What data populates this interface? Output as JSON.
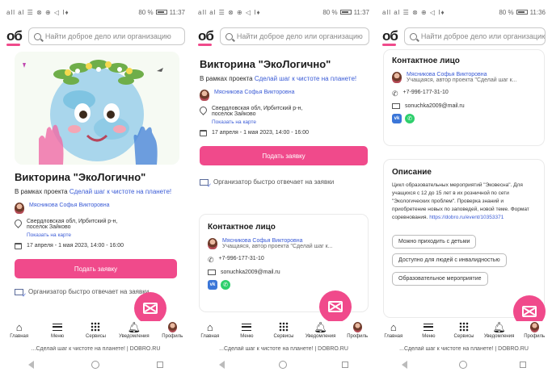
{
  "status": {
    "signal": "all al ☰ ⊗ ⊕ ◁ I♦",
    "battery": "80 %",
    "times": [
      "11:37",
      "11:37",
      "11:36"
    ]
  },
  "header": {
    "logo": "об",
    "search_placeholder": "Найти доброе дело или организацию"
  },
  "event": {
    "title": "Викторина \"ЭкоЛогично\"",
    "subtitle_prefix": "В рамках проекта ",
    "project_link": "Сделай шаг к чистоте на планете!",
    "organizer_name": "Мясникова Софья Викторовна",
    "address": "Свердловская обл, Ирбитский р-н, поселок Зайково",
    "map_link": "Показать на карте",
    "dates": "17 апреля - 1 мая 2023, 14:00 - 16:00",
    "apply_button": "Подать заявку",
    "fast_reply_note": "Организатор быстро отвечает на заявки"
  },
  "contact": {
    "title": "Контактное лицо",
    "name": "Мясникова Софья Викторовна",
    "role": "Учащаяся, автор проекта \"Сделай шаг к...",
    "phone": "+7-996-177-31-10",
    "email": "sonuchka2009@mail.ru",
    "vk": "vk",
    "whatsapp": "✆"
  },
  "description": {
    "title": "Описание",
    "text": "Цикл образовательных мероприятий \"Эковесна\". Для учащихся с 12 до 15 лет в их розничной по сети \"Экологических проблем\". Проверка знаний и приобретение новых по заповедей, новой теме. Формат соревнования. ",
    "link": "https://dobro.ru/event/10353371",
    "tags": [
      "Можно приходить с детьми",
      "Доступно для людей с инвалидностью",
      "Образовательное мероприятие"
    ]
  },
  "nav": {
    "items": [
      "Главная",
      "Меню",
      "Сервисы",
      "Уведомления",
      "Профиль"
    ]
  },
  "urlbar": "...Сделай шаг к чистоте на планете! | DOBRO.RU",
  "colors": {
    "accent": "#f04a8b",
    "link": "#3a5bd6"
  }
}
